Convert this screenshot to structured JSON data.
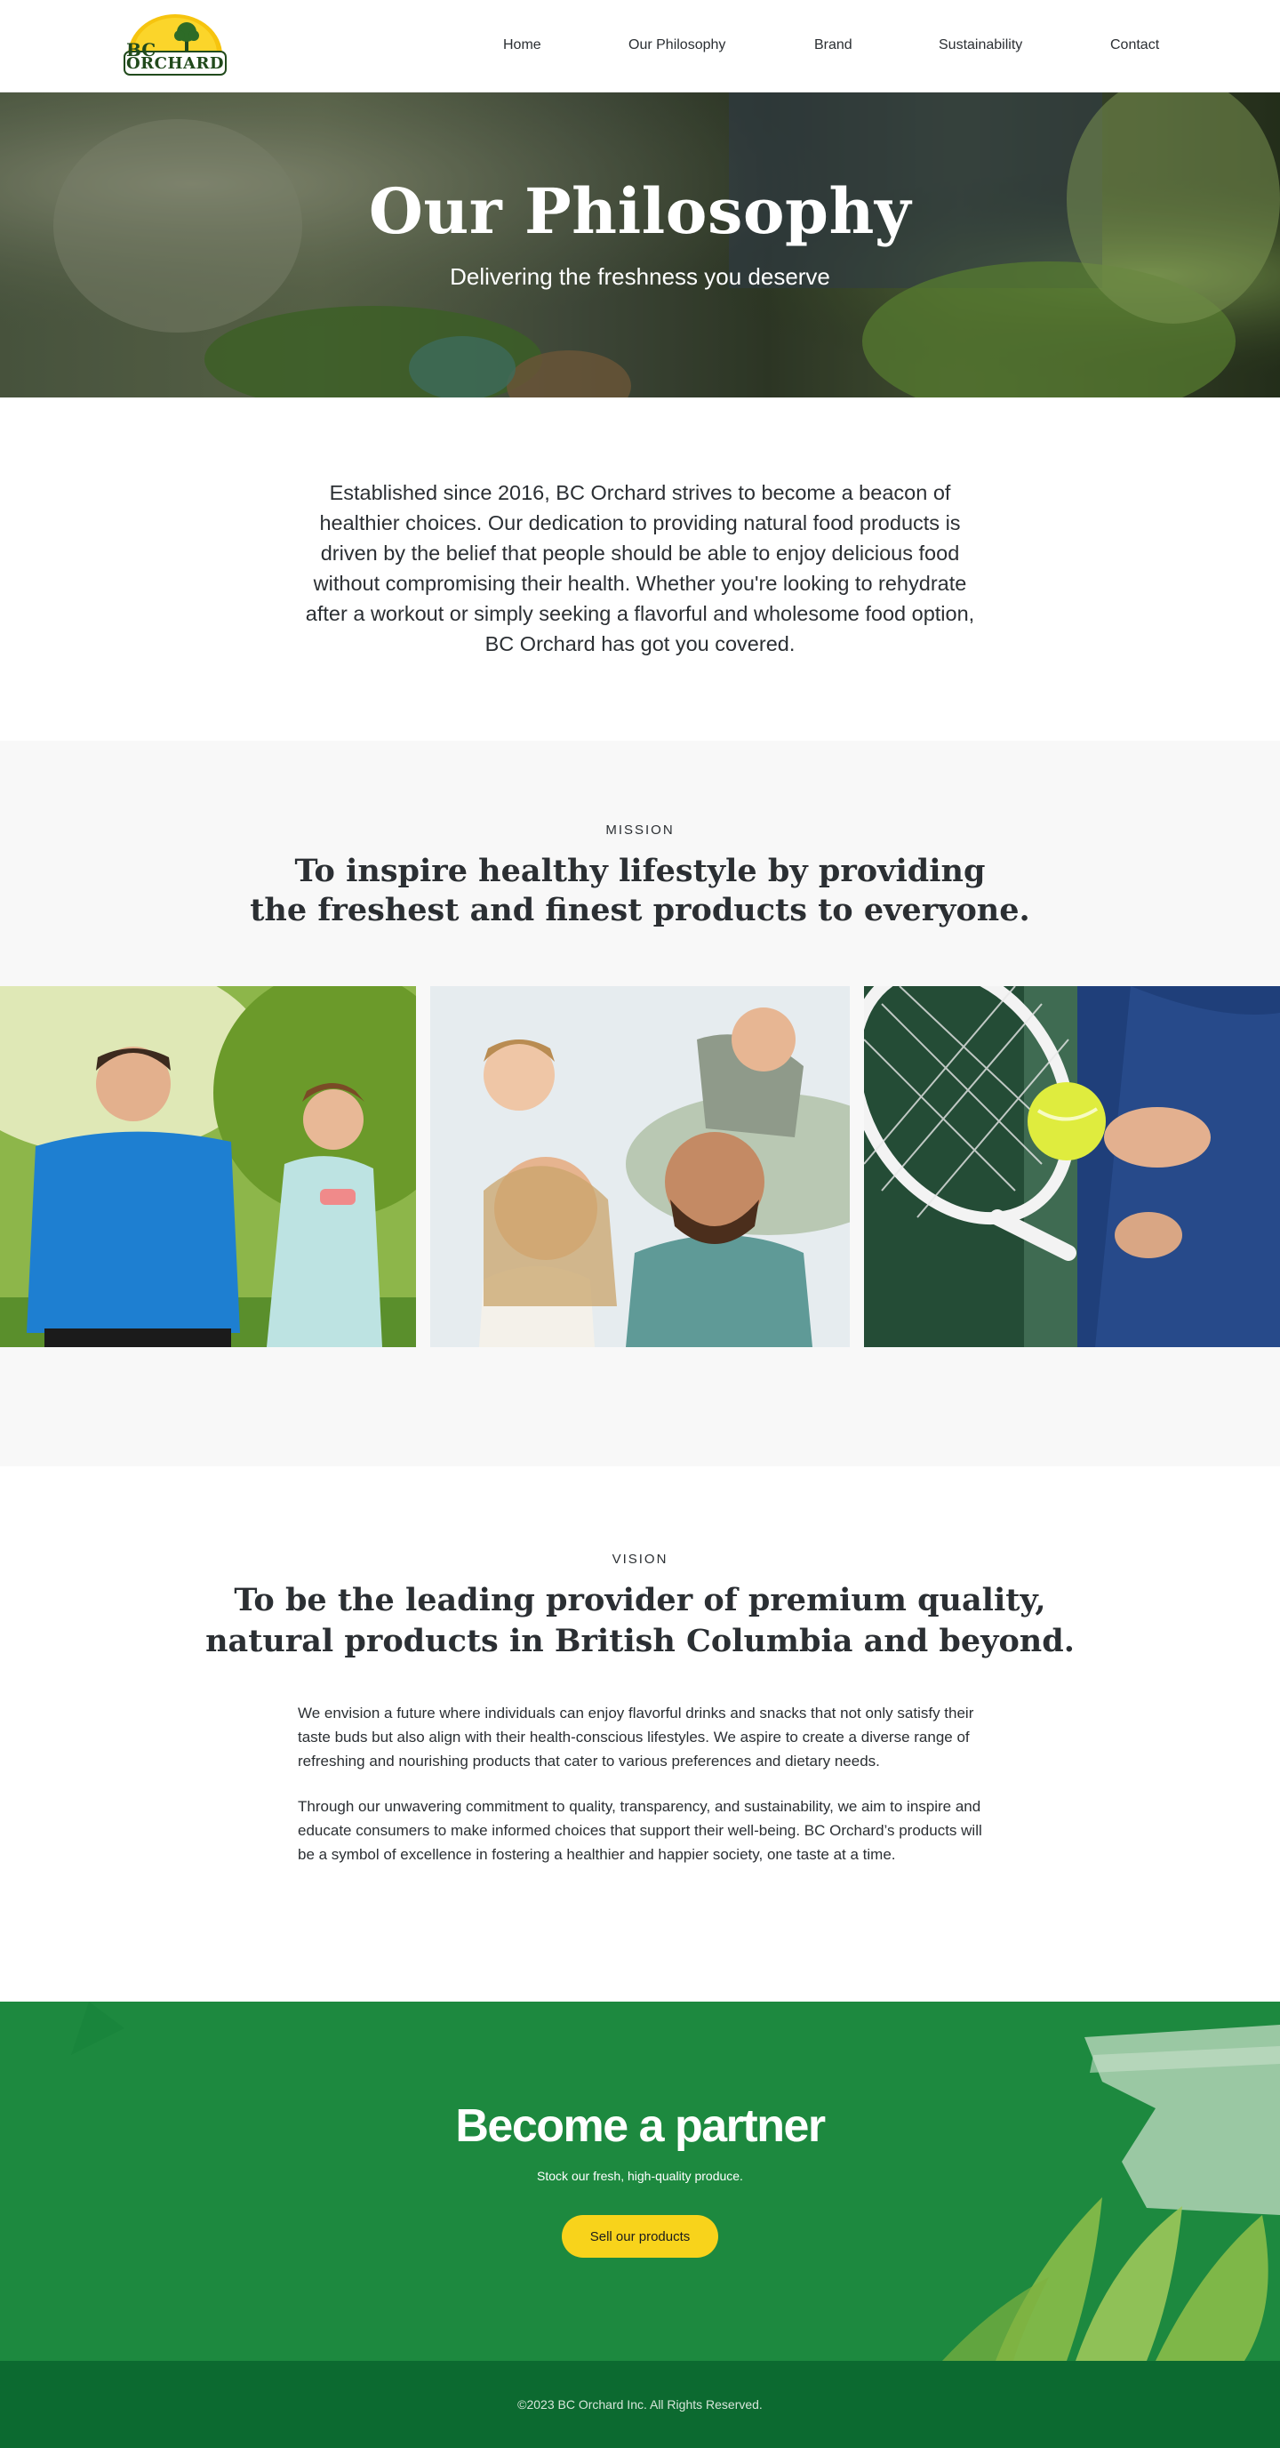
{
  "brand": {
    "logo_line1": "BC",
    "logo_line2": "ORCHARD",
    "logo_icon": "tree-sun-logo"
  },
  "nav": {
    "items": [
      {
        "label": "Home"
      },
      {
        "label": "Our Philosophy"
      },
      {
        "label": "Brand"
      },
      {
        "label": "Sustainability"
      },
      {
        "label": "Contact"
      }
    ]
  },
  "hero": {
    "title": "Our Philosophy",
    "subtitle": "Delivering the freshness you deserve"
  },
  "intro": {
    "text": "Established since 2016, BC Orchard strives to become a beacon of healthier choices. Our dedication to providing natural food products is driven by the belief that people should be able to enjoy delicious food without compromising their health. Whether you're looking to rehydrate after a workout or simply seeking a flavorful and wholesome food option, BC Orchard has got you covered."
  },
  "mission": {
    "eyebrow": "MISSION",
    "headline_line1": "To inspire healthy lifestyle by providing",
    "headline_line2": "the freshest and finest products to everyone."
  },
  "vision": {
    "eyebrow": "VISION",
    "headline_line1": "To be the leading provider of premium quality,",
    "headline_line2": "natural products in British Columbia and beyond.",
    "paragraph1": "We envision a future where individuals can enjoy flavorful drinks and snacks that not only satisfy their taste buds but also align with their health-conscious lifestyles. We aspire to create a diverse range of refreshing and nourishing products that cater to various preferences and dietary needs.",
    "paragraph2": "Through our unwavering commitment to quality, transparency, and sustainability, we aim to inspire and educate consumers to make informed choices that support their well-being. BC Orchard’s products will be a symbol of excellence in fostering a healthier and happier society, one taste at a time."
  },
  "partner": {
    "title": "Become a partner",
    "subtitle": "Stock our fresh, high-quality produce.",
    "button_label": "Sell our products"
  },
  "footer": {
    "copyright": "©2023 BC Orchard Inc. All Rights Reserved."
  },
  "colors": {
    "accent_yellow": "#f8d31b",
    "partner_green": "#1e8d41",
    "footer_green": "#0c6a30",
    "text_dark": "#2b2f33",
    "section_gray": "#f8f8f8"
  }
}
